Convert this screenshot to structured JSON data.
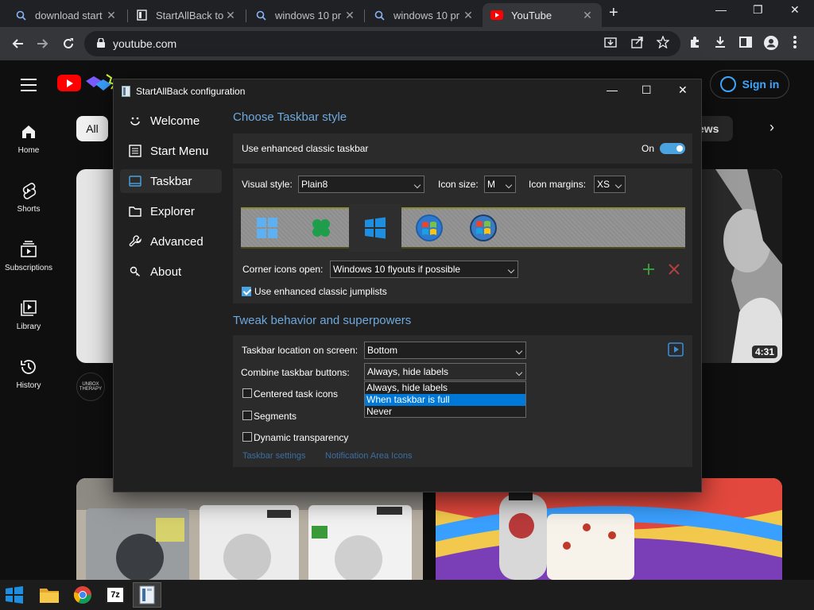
{
  "browser": {
    "tabs": [
      {
        "label": "download start",
        "icon": "search-icon"
      },
      {
        "label": "StartAllBack to",
        "icon": "doc-icon"
      },
      {
        "label": "windows 10 pr",
        "icon": "search-icon"
      },
      {
        "label": "windows 10 pr",
        "icon": "search-icon"
      },
      {
        "label": "YouTube",
        "icon": "youtube-icon"
      }
    ],
    "new_tab": "+",
    "url": "youtube.com",
    "window_controls": {
      "minimize": "—",
      "restore": "❐",
      "close": "✕"
    }
  },
  "youtube": {
    "sign_in": "Sign in",
    "chips": {
      "all": "All",
      "news": "ews"
    },
    "sidebar": [
      {
        "label": "Home",
        "icon": "home-icon"
      },
      {
        "label": "Shorts",
        "icon": "shorts-icon"
      },
      {
        "label": "Subscriptions",
        "icon": "subscriptions-icon"
      },
      {
        "label": "Library",
        "icon": "library-icon"
      },
      {
        "label": "History",
        "icon": "history-icon"
      }
    ],
    "video_duration": "4:31",
    "channel_avatar_text": "UNBOX THERAPY"
  },
  "dialog": {
    "title": "StartAllBack configuration",
    "nav": [
      {
        "label": "Welcome",
        "icon": "smile-icon"
      },
      {
        "label": "Start Menu",
        "icon": "start-menu-icon"
      },
      {
        "label": "Taskbar",
        "icon": "taskbar-icon",
        "selected": true
      },
      {
        "label": "Explorer",
        "icon": "folder-icon"
      },
      {
        "label": "Advanced",
        "icon": "wrench-icon"
      },
      {
        "label": "About",
        "icon": "info-icon"
      }
    ],
    "section_style": "Choose Taskbar style",
    "enhanced_taskbar_label": "Use enhanced classic taskbar",
    "enhanced_taskbar_state": "On",
    "visual_style_label": "Visual style:",
    "visual_style_value": "Plain8",
    "icon_size_label": "Icon size:",
    "icon_size_value": "M",
    "icon_margins_label": "Icon margins:",
    "icon_margins_value": "XS",
    "style_options": [
      "windows-11-logo-icon",
      "windows-8-logo-icon",
      "windows-10-logo-icon",
      "windows-7-orb-icon",
      "windows-vista-orb-icon"
    ],
    "selected_style_index": 2,
    "corner_icons_label": "Corner icons open:",
    "corner_icons_value": "Windows 10 flyouts if possible",
    "jumplists_label": "Use enhanced classic jumplists",
    "jumplists_checked": true,
    "section_behavior": "Tweak behavior and superpowers",
    "location_label": "Taskbar location on screen:",
    "location_value": "Bottom",
    "combine_label": "Combine taskbar buttons:",
    "combine_value": "Always, hide labels",
    "combine_options": [
      "Always, hide labels",
      "When taskbar is full",
      "Never"
    ],
    "combine_highlighted_index": 1,
    "centered_label": "Centered task icons",
    "segments_label": "Segments",
    "dynamic_label": "Dynamic transparency",
    "link_taskbar_settings": "Taskbar settings",
    "link_notification_icons": "Notification Area Icons"
  },
  "taskbar": {
    "items": [
      "windows-start-icon",
      "file-explorer-icon",
      "chrome-icon",
      "7zip-icon",
      "startallback-icon"
    ],
    "zip_label": "7z"
  }
}
